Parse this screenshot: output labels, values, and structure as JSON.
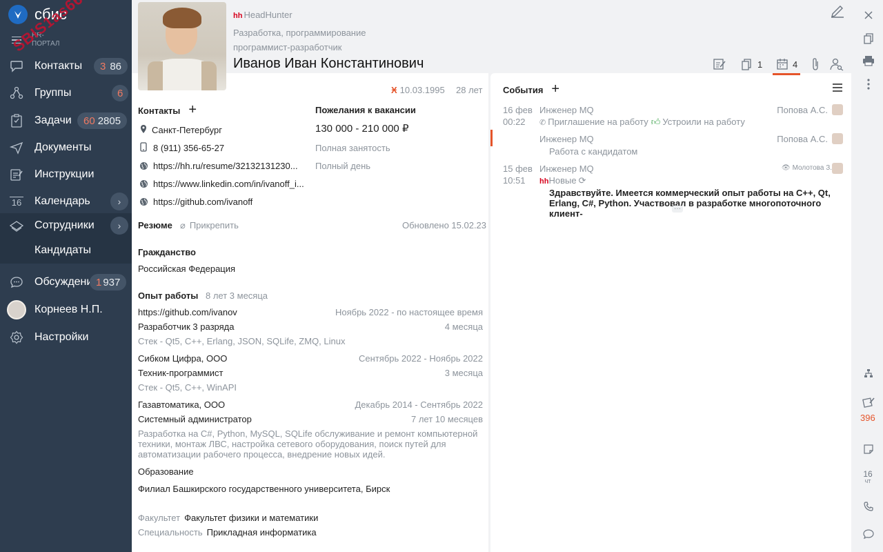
{
  "sidebar": {
    "logo_text": "сбис",
    "watermark": "SBIS1as66",
    "hr_portal": "HR-\nПОРТАЛ",
    "items": [
      {
        "label": "Контакты",
        "badge_red": "3",
        "badge": "86",
        "icon": "chat-icon"
      },
      {
        "label": "Группы",
        "badge_red": "6",
        "badge": "",
        "icon": "groups-icon"
      },
      {
        "label": "Задачи",
        "badge_red": "60",
        "badge": "2805",
        "icon": "tasks-icon"
      },
      {
        "label": "Документы",
        "icon": "documents-icon"
      },
      {
        "label": "Инструкции",
        "icon": "instructions-icon"
      },
      {
        "label": "Календарь",
        "icon": "calendar-icon",
        "cal_num": "16"
      },
      {
        "label": "Сотрудники",
        "icon": "employees-icon"
      },
      {
        "label": "Кандидаты"
      },
      {
        "label": "Обсуждения",
        "badge_red": "1",
        "badge": "937",
        "icon": "discussions-icon"
      },
      {
        "label": "Корнеев Н.П."
      },
      {
        "label": "Настройки",
        "icon": "settings-icon"
      }
    ]
  },
  "header": {
    "source_tag": "hh",
    "source": "HeadHunter",
    "sphere": "Разработка, программирование",
    "position": "программист-разработчик",
    "fullname": "Иванов Иван Константинович",
    "counts": {
      "docs": "1",
      "calendar": "4"
    }
  },
  "profile": {
    "birth_date": "10.03.1995",
    "age": "28 лет",
    "contacts_title": "Контакты",
    "city": "Санкт-Петербург",
    "phone": "8 (911) 356-65-27",
    "links": [
      "https://hh.ru/resume/32132131230...",
      "https://www.linkedin.com/in/ivanoff_i...",
      "https://github.com/ivanoff"
    ],
    "wishes_title": "Пожелания к вакансии",
    "salary": "130 000 - 210 000 ₽",
    "employment": "Полная занятость",
    "schedule": "Полный день",
    "resume_title": "Резюме",
    "attach": "Прикрепить",
    "updated": "Обновлено 15.02.23",
    "citizenship_title": "Гражданство",
    "citizenship": "Российская Федерация",
    "experience_title": "Опыт работы",
    "experience_total": "8 лет 3 месяца",
    "jobs": [
      {
        "company": "https://github.com/ivanov",
        "period": "Ноябрь 2022 - по настоящее время",
        "role": "Разработчик 3 разряда",
        "duration": "4 месяца",
        "desc": "Стек - Qt5, C++, Erlang, JSON, SQLife, ZMQ, Linux"
      },
      {
        "company": "Сибком Цифра, ООО",
        "period": "Сентябрь 2022 - Ноябрь 2022",
        "role": "Техник-программист",
        "duration": "3 месяца",
        "desc": "Стек - Qt5, C++, WinAPI"
      },
      {
        "company": "Газавтоматика, ООО",
        "period": "Декабрь 2014 - Сентябрь 2022",
        "role": "Системный администратор",
        "duration": "7 лет 10 месяцев",
        "desc": "Разработка на C#, Python, MySQL, SQLife обслуживание и ремонт компьютерной техники, монтаж ЛВС, настройка сетевого оборудования, поиск путей для автоматизации рабочего процесса, внедрение новых идей."
      }
    ],
    "education_title": "Образование",
    "university": "Филиал Башкирского государственного университета, Бирск",
    "faculty_label": "Факультет",
    "faculty": "Факультет физики и математики",
    "specialty_label": "Специальность",
    "specialty": "Прикладная информатика"
  },
  "events": {
    "title": "События",
    "items": [
      {
        "date": "16 фев",
        "time": "00:22",
        "title": "Инженер MQ",
        "person": "Попова А.С.",
        "line1": "Приглашение на работу",
        "line2": "Устроили на работу"
      },
      {
        "date": "",
        "time": "",
        "title": "Инженер MQ",
        "person": "Попова А.С.",
        "line1": "Работа с кандидатом"
      },
      {
        "date": "15 фев",
        "time": "10:51",
        "title": "Инженер MQ",
        "person": "Молотова З.И.",
        "tag": "hh",
        "status": "Новые",
        "message": "Здравствуйте. Имеется коммерческий опыт работы на C++, Qt, Erlang, C#, Python. Участвовал в разработке многопоточного клиент-"
      }
    ]
  },
  "right_strip": {
    "badge": "396",
    "cal_num": "16",
    "cal_day": "ЧТ"
  },
  "colors": {
    "sidebar": "#2e3d4f",
    "accent_red": "#e5542a",
    "hh": "#d6001c"
  }
}
